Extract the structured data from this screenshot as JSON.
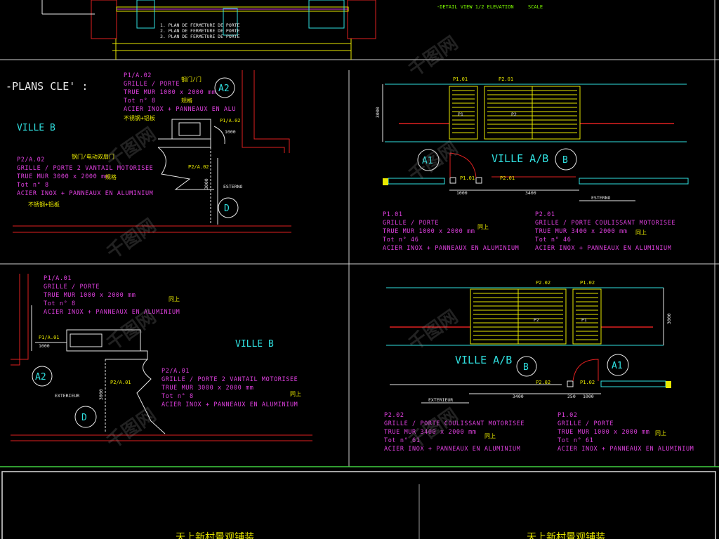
{
  "top": {
    "title_right": "-DETAIL VIEW 1/2 ELEVATION",
    "title_right_tag": "SCALE",
    "small_notes": [
      "1. PLAN DE FERMETURE DE PORTE",
      "2. PLAN DE FERMETURE DE PORTE",
      "3. PLAN DE FERMETURE DE PORTE"
    ]
  },
  "plans_cle": {
    "heading": "-PLANS CLE' :",
    "q1": {
      "ville": "VILLE B",
      "block1": {
        "ref": "P1/A.02",
        "lines": [
          "GRILLE / PORTE",
          "TRUE MUR 1000 x 2000 mm",
          "Tot n° 8",
          "ACIER INOX + PANNEAUX EN ALU"
        ],
        "cn1": "钢门/门",
        "cn2": "规格",
        "cn3": "不锈钢+铝板"
      },
      "block2": {
        "ref": "P2/A.02",
        "lines": [
          "GRILLE / PORTE 2 VANTAIL MOTORISEE",
          "TRUE MUR 3000 x 2000 mm",
          "Tot n° 8",
          "ACIER INOX + PANNEAUX EN ALUMINIUM"
        ],
        "cn1": "钢门/电动双扇门",
        "cn2": "规格",
        "cn3": "不锈钢+铝板"
      },
      "tag_p1": "P1/A.02",
      "tag_p2": "P2/A.02",
      "dim_1000": "1000",
      "dim_3000": "3000",
      "exterior": "ESTERNO",
      "circle_a2": "A2",
      "circle_d": "D"
    },
    "q2": {
      "ville": "VILLE A/B",
      "tag_p101": "P1.01",
      "tag_p201": "P2.01",
      "tag_p101b": "P1.01",
      "tag_p201b": "P2.01",
      "dim_1000": "1000",
      "dim_3400": "3400",
      "dim_v": "3000",
      "exterior": "ESTERNO",
      "circle_a1": "A1",
      "circle_b": "B",
      "panel_p1": "P1",
      "panel_p2": "P2",
      "block1": {
        "ref": "P1.01",
        "lines": [
          "GRILLE / PORTE",
          "TRUE MUR 1000 x 2000 mm",
          "Tot n° 46",
          "ACIER INOX + PANNEAUX EN ALUMINIUM"
        ],
        "cn": "同上"
      },
      "block2": {
        "ref": "P2.01",
        "lines": [
          "GRILLE / PORTE COULISSANT MOTORISEE",
          "TRUE MUR 3400 x 2000 mm",
          "Tot n° 46",
          "ACIER INOX + PANNEAUX EN ALUMINIUM"
        ],
        "cn": "同上"
      }
    },
    "q3": {
      "ville": "VILLE B",
      "block1": {
        "ref": "P1/A.01",
        "lines": [
          "GRILLE / PORTE",
          "TRUE MUR 1000 x 2000 mm",
          "Tot n° 8",
          "ACIER INOX + PANNEAUX EN ALUMINIUM"
        ],
        "cn": "同上"
      },
      "block2": {
        "ref": "P2/A.01",
        "lines": [
          "GRILLE / PORTE 2 VANTAIL MOTORISEE",
          "TRUE MUR 3000 x 2000 mm",
          "Tot n° 8",
          "ACIER INOX + PANNEAUX EN ALUMINIUM"
        ],
        "cn": "同上"
      },
      "tag_p1": "P1/A.01",
      "tag_p2": "P2/A.01",
      "dim_1000": "1000",
      "dim_3000": "3000",
      "exterior": "EXTERIEUR",
      "circle_a2": "A2",
      "circle_d": "D"
    },
    "q4": {
      "ville": "VILLE A/B",
      "tag_p202": "P2.02",
      "tag_p102": "P1.02",
      "tag_p202b": "P2.02",
      "tag_p102b": "P1.02",
      "dim_3400": "3400",
      "dim_250": "250",
      "dim_1000": "1000",
      "dim_v": "3000",
      "exterior": "EXTERIEUR",
      "circle_b": "B",
      "circle_a1": "A1",
      "panel_p2": "P2",
      "panel_p1": "P1",
      "block1": {
        "ref": "P2.02",
        "lines": [
          "GRILLE / PORTE COULISSANT MOTORISEE",
          "TRUE MUR 3400 x 2000 mm",
          "Tot n° 61",
          "ACIER INOX + PANNEAUX EN ALUMINIUM"
        ],
        "cn": "同上"
      },
      "block2": {
        "ref": "P1.02",
        "lines": [
          "GRILLE / PORTE",
          "TRUE MUR 1000 x 2000 mm",
          "Tot n° 61",
          "ACIER INOX + PANNEAUX EN ALUMINIUM"
        ],
        "cn": "同上"
      }
    }
  },
  "bottom": {
    "title_left": "天上新村景观铺装",
    "title_right": "天上新村景观铺装"
  },
  "watermark": {
    "text": "千图网"
  },
  "colors": {
    "magenta": "#e040e0",
    "yellow": "#e8e800",
    "cyan": "#30e0e0",
    "red": "#e02020",
    "green": "#80ff00",
    "white": "#e8e8e8",
    "frame": "#dcdcdc"
  }
}
